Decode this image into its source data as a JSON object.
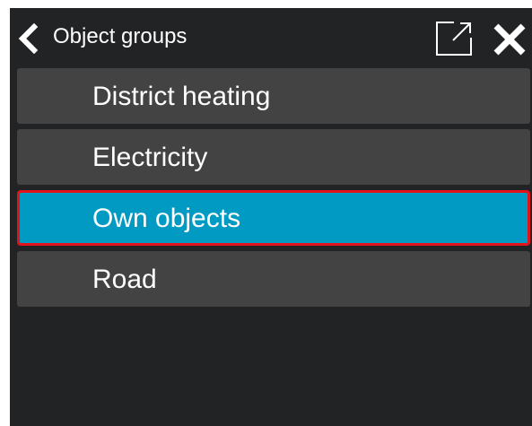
{
  "header": {
    "title": "Object groups",
    "back_icon": "chevron-left-icon",
    "popout_icon": "open-in-new-window-icon",
    "close_icon": "close-icon"
  },
  "groups": {
    "selected_index": 2,
    "items": [
      {
        "label": "District heating"
      },
      {
        "label": "Electricity"
      },
      {
        "label": "Own objects"
      },
      {
        "label": "Road"
      }
    ]
  },
  "colors": {
    "panel_background": "#222325",
    "item_background": "#434343",
    "selected_background": "#009ac3",
    "selected_border": "#e1141c",
    "text": "#ffffff"
  }
}
